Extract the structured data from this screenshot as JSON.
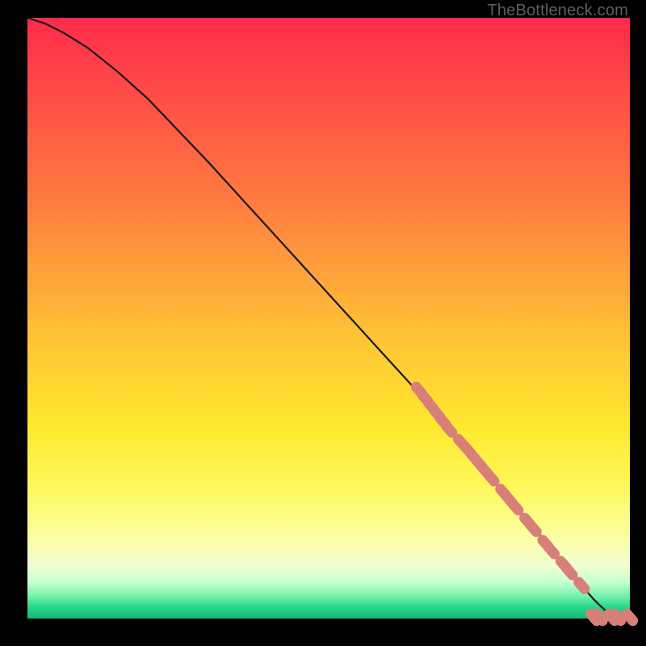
{
  "watermark": "TheBottleneck.com",
  "colors": {
    "bg": "#000000",
    "curve": "#1a1a1a",
    "marker": "#d87f7a",
    "grad_top": "#ff2b4b",
    "grad_mid1": "#ffa03a",
    "grad_mid2": "#ffe82e",
    "grad_bottom": "#12b77a"
  },
  "chart_data": {
    "type": "line",
    "title": "",
    "xlabel": "",
    "ylabel": "",
    "xlim": [
      0,
      100
    ],
    "ylim": [
      0,
      100
    ],
    "series": [
      {
        "name": "curve",
        "x": [
          0,
          3,
          6,
          10,
          15,
          20,
          30,
          40,
          50,
          60,
          70,
          80,
          85,
          90,
          92,
          94,
          95,
          96,
          97,
          98,
          99,
          100
        ],
        "y": [
          100,
          99,
          97.5,
          95,
          91,
          86.5,
          76,
          65,
          54,
          43,
          32,
          20,
          14,
          8,
          5.5,
          3.2,
          2.2,
          1.3,
          0.7,
          0.3,
          0.1,
          0
        ]
      }
    ],
    "markers": [
      {
        "x": 65,
        "y": 38
      },
      {
        "x": 66,
        "y": 36.7
      },
      {
        "x": 67,
        "y": 35.4
      },
      {
        "x": 68,
        "y": 34.1
      },
      {
        "x": 69,
        "y": 32.8
      },
      {
        "x": 70,
        "y": 31.5
      },
      {
        "x": 72,
        "y": 29.3
      },
      {
        "x": 73,
        "y": 28.2
      },
      {
        "x": 74,
        "y": 27.0
      },
      {
        "x": 75,
        "y": 25.8
      },
      {
        "x": 76,
        "y": 24.6
      },
      {
        "x": 77,
        "y": 23.4
      },
      {
        "x": 79,
        "y": 21.0
      },
      {
        "x": 80,
        "y": 19.8
      },
      {
        "x": 81,
        "y": 18.6
      },
      {
        "x": 83,
        "y": 16.2
      },
      {
        "x": 84,
        "y": 15.0
      },
      {
        "x": 86,
        "y": 12.5
      },
      {
        "x": 87,
        "y": 11.3
      },
      {
        "x": 89,
        "y": 9.0
      },
      {
        "x": 90,
        "y": 7.8
      },
      {
        "x": 92,
        "y": 5.5
      },
      {
        "x": 94,
        "y": 0.2
      },
      {
        "x": 95,
        "y": 0.2
      },
      {
        "x": 97,
        "y": 0.2
      },
      {
        "x": 98,
        "y": 0.2
      },
      {
        "x": 100,
        "y": 0.2
      }
    ]
  }
}
